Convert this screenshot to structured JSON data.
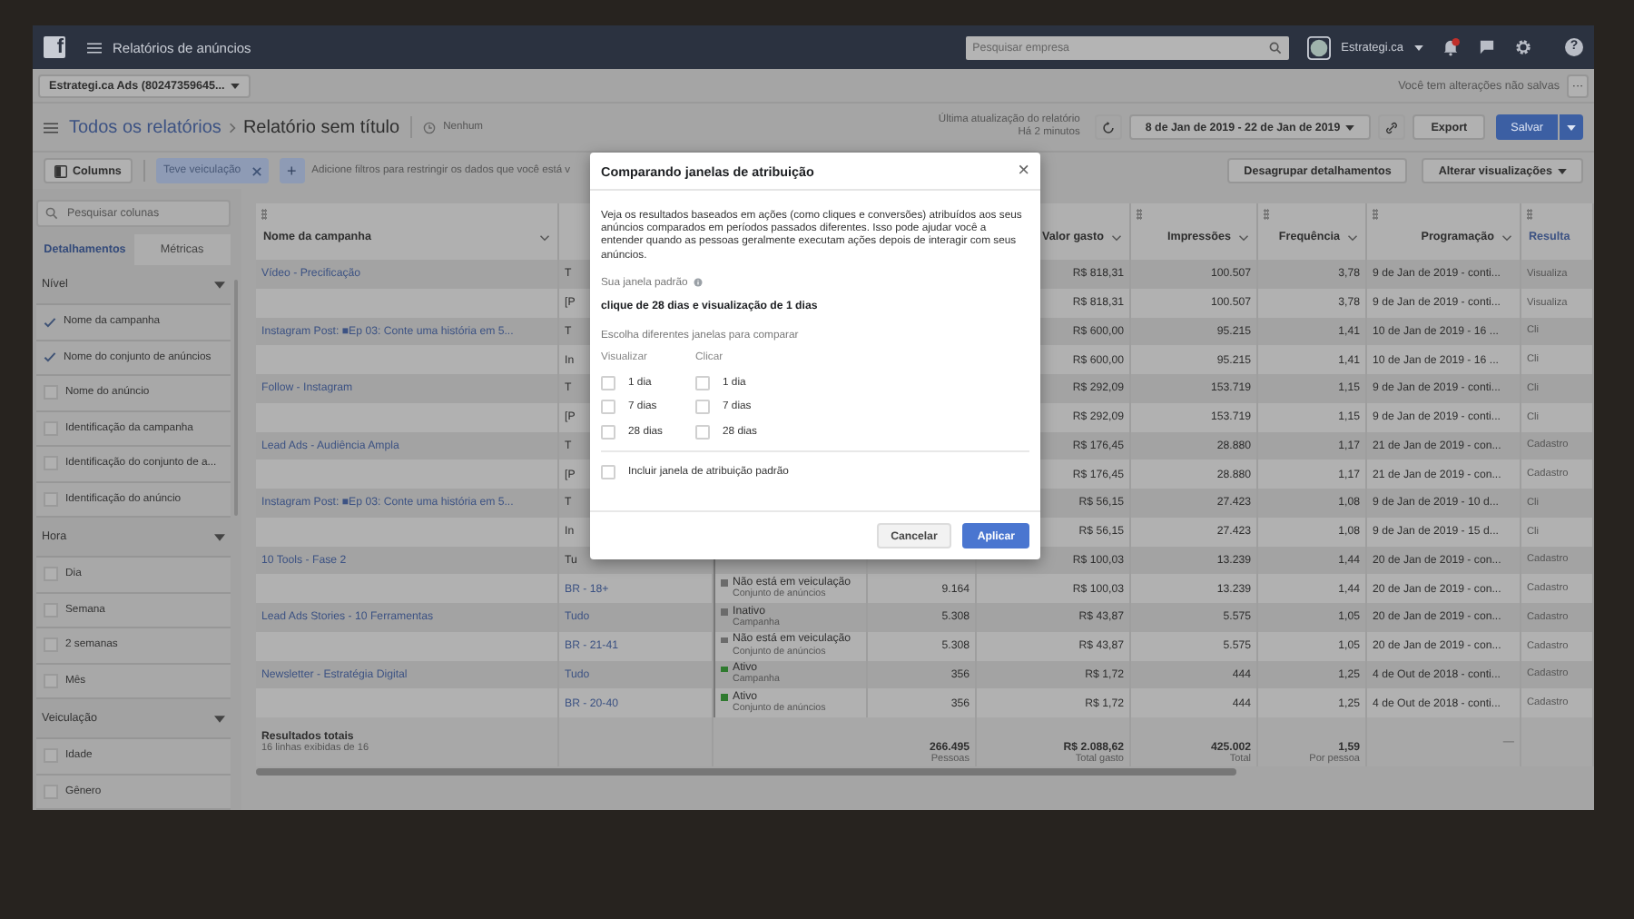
{
  "top_bar": {
    "logo": "f",
    "title": "Relatórios de anúncios",
    "search": {
      "placeholder": "Pesquisar empresa"
    },
    "account": "Estrategi.ca",
    "help": "?"
  },
  "account_selector": "Estrategi.ca Ads (80247359645...",
  "unsaved_notice": "Você tem alterações não salvas",
  "more_button": "···",
  "breadcrumb": {
    "parent": "Todos os relatórios",
    "current": "Relatório sem título",
    "schedule": "Nenhum"
  },
  "last_update": {
    "label": "Última atualização do relatório",
    "time": "Há 2 minutos"
  },
  "date_range": "8 de Jan de 2019 - 22 de Jan de 2019",
  "export_button": "Export",
  "save_button": "Salvar",
  "toolbar": {
    "columns_button": "Columns",
    "filter_chip": "Teve veiculação",
    "add_filter": "+",
    "filter_hint": "Adicione filtros para restringir os dados que você está v",
    "ungroup_button": "Desagrupar detalhamentos",
    "views_button": "Alterar visualizações"
  },
  "sidebar": {
    "search": {
      "placeholder": "Pesquisar colunas"
    },
    "tabs": [
      {
        "label": "Detalhamentos",
        "selected": true
      },
      {
        "label": "Métricas",
        "selected": false
      }
    ],
    "sections": [
      {
        "title": "Nível",
        "expanded": true,
        "items": [
          {
            "label": "Nome da campanha",
            "checked": true
          },
          {
            "label": "Nome do conjunto de anúncios",
            "checked": true
          },
          {
            "label": "Nome do anúncio",
            "checked": false
          },
          {
            "label": "Identificação da campanha",
            "checked": false
          },
          {
            "label": "Identificação do conjunto de a...",
            "checked": false
          },
          {
            "label": "Identificação do anúncio",
            "checked": false
          }
        ]
      },
      {
        "title": "Hora",
        "expanded": true,
        "items": [
          {
            "label": "Dia",
            "checked": false
          },
          {
            "label": "Semana",
            "checked": false
          },
          {
            "label": "2 semanas",
            "checked": false
          },
          {
            "label": "Mês",
            "checked": false
          }
        ]
      },
      {
        "title": "Veiculação",
        "expanded": true,
        "items": [
          {
            "label": "Idade",
            "checked": false
          },
          {
            "label": "Gênero",
            "checked": false
          }
        ]
      }
    ]
  },
  "table": {
    "headers": {
      "campaign": "Nome da campanha",
      "spent": "Valor gasto",
      "impressions": "Impressões",
      "frequency": "Frequência",
      "schedule": "Programação",
      "result": "Resulta"
    },
    "rows": [
      {
        "campaign": "Vídeo - Precificação",
        "column_2": "T",
        "spent": "R$ 818,31",
        "impressions": "100.507",
        "frequency": "3,78",
        "schedule": "9 de Jan de 2019 - conti...",
        "result": "Visualiza"
      },
      {
        "column_2": "[P",
        "spent": "R$ 818,31",
        "impressions": "100.507",
        "frequency": "3,78",
        "schedule": "9 de Jan de 2019 - conti...",
        "result": "Visualiza"
      },
      {
        "campaign": "Instagram Post: ■Ep 03: Conte uma história em 5...",
        "column_2": "T",
        "spent": "R$ 600,00",
        "impressions": "95.215",
        "frequency": "1,41",
        "schedule": "10 de Jan de 2019 - 16 ...",
        "result": "Cli"
      },
      {
        "column_2": "In",
        "spent": "R$ 600,00",
        "impressions": "95.215",
        "frequency": "1,41",
        "schedule": "10 de Jan de 2019 - 16 ...",
        "result": "Cli"
      },
      {
        "campaign": "Follow - Instagram",
        "column_2": "T",
        "spent": "R$ 292,09",
        "impressions": "153.719",
        "frequency": "1,15",
        "schedule": "9 de Jan de 2019 - conti...",
        "result": "Cli"
      },
      {
        "column_2": "[P",
        "spent": "R$ 292,09",
        "impressions": "153.719",
        "frequency": "1,15",
        "schedule": "9 de Jan de 2019 - conti...",
        "result": "Cli"
      },
      {
        "campaign": "Lead Ads - Audiência Ampla",
        "column_2": "T",
        "spent": "R$ 176,45",
        "impressions": "28.880",
        "frequency": "1,17",
        "schedule": "21 de Jan de 2019 - con...",
        "result": "Cadastro"
      },
      {
        "column_2": "[P",
        "spent": "R$ 176,45",
        "impressions": "28.880",
        "frequency": "1,17",
        "schedule": "21 de Jan de 2019 - con...",
        "result": "Cadastro"
      },
      {
        "campaign": "Instagram Post: ■Ep 03: Conte uma história em 5...",
        "column_2": "T",
        "spent": "R$ 56,15",
        "impressions": "27.423",
        "frequency": "1,08",
        "schedule": "9 de Jan de 2019 - 10 d...",
        "result": "Cli"
      },
      {
        "column_2": "In",
        "spent": "R$ 56,15",
        "impressions": "27.423",
        "frequency": "1,08",
        "schedule": "9 de Jan de 2019 - 15 d...",
        "result": "Cli"
      },
      {
        "campaign": "10 Tools - Fase 2",
        "column_2": "Tu",
        "spent": "R$ 100,03",
        "impressions": "13.239",
        "frequency": "1,44",
        "schedule": "20 de Jan de 2019 - con...",
        "result": "Cadastro"
      },
      {
        "column_2": "BR - 18+",
        "status": {
          "label": "Não está em veiculação",
          "level_text": "Conjunto de anúncios",
          "color": "#6b6b6b"
        },
        "column_4": "9.164",
        "spent": "R$ 100,03",
        "impressions": "13.239",
        "frequency": "1,44",
        "schedule": "20 de Jan de 2019 - con...",
        "result": "Cadastro"
      },
      {
        "campaign": "Lead Ads Stories - 10 Ferramentas",
        "column_2": "Tudo",
        "status": {
          "label": "Inativo",
          "level_text": "Campanha",
          "color": "#6b6b6b"
        },
        "column_4": "5.308",
        "spent": "R$ 43,87",
        "impressions": "5.575",
        "frequency": "1,05",
        "schedule": "20 de Jan de 2019 - con...",
        "result": "Cadastro"
      },
      {
        "column_2": "BR - 21-41",
        "status": {
          "label": "Não está em veiculação",
          "level_text": "Conjunto de anúncios",
          "color": "#6b6b6b"
        },
        "column_4": "5.308",
        "spent": "R$ 43,87",
        "impressions": "5.575",
        "frequency": "1,05",
        "schedule": "20 de Jan de 2019 - con...",
        "result": "Cadastro"
      },
      {
        "campaign": "Newsletter - Estratégia Digital",
        "column_2": "Tudo",
        "status": {
          "label": "Ativo",
          "level_text": "Campanha",
          "color": "#2f7a2f"
        },
        "column_4": "356",
        "spent": "R$ 1,72",
        "impressions": "444",
        "frequency": "1,25",
        "schedule": "4 de Out de 2018 - conti...",
        "result": "Cadastro"
      },
      {
        "column_2": "BR - 20-40",
        "status": {
          "label": "Ativo",
          "level_text": "Conjunto de anúncios",
          "color": "#2f7a2f"
        },
        "column_4": "356",
        "spent": "R$ 1,72",
        "impressions": "444",
        "frequency": "1,25",
        "schedule": "4 de Out de 2018 - conti...",
        "result": "Cadastro"
      }
    ],
    "totals": {
      "title": "Resultados totais",
      "subtitle": "16 linhas exibidas de 16",
      "column_4": {
        "value": "266.495",
        "unit": "Pessoas"
      },
      "spent": {
        "value": "R$ 2.088,62",
        "unit": "Total gasto"
      },
      "impressions": {
        "value": "425.002",
        "unit": "Total"
      },
      "frequency": {
        "value": "1,59",
        "unit": "Por pessoa"
      },
      "schedule": "—"
    }
  },
  "dialog": {
    "title": "Comparando janelas de atribuição",
    "close": "×",
    "description": "Veja os resultados baseados em ações (como cliques e conversões) atribuídos aos seus anúncios comparados em períodos passados diferentes. Isso pode ajudar você a entender quando as pessoas geralmente executam ações depois de interagir com seus anúncios.",
    "default_label": "Sua janela padrão",
    "default_value": "clique de 28 dias e visualização de 1 dias",
    "compare_label": "Escolha diferentes janelas para comparar",
    "groups": [
      {
        "title": "Visualizar",
        "options": [
          {
            "label": "1 dia",
            "checked": false
          },
          {
            "label": "7 dias",
            "checked": false
          },
          {
            "label": "28 dias",
            "checked": false
          }
        ]
      },
      {
        "title": "Clicar",
        "options": [
          {
            "label": "1 dia",
            "checked": false
          },
          {
            "label": "7 dias",
            "checked": false
          },
          {
            "label": "28 dias",
            "checked": false
          }
        ]
      }
    ],
    "include_default": {
      "label": "Incluir janela de atribuição padrão",
      "checked": false
    },
    "cancel_button": "Cancelar",
    "apply_button": "Aplicar"
  }
}
